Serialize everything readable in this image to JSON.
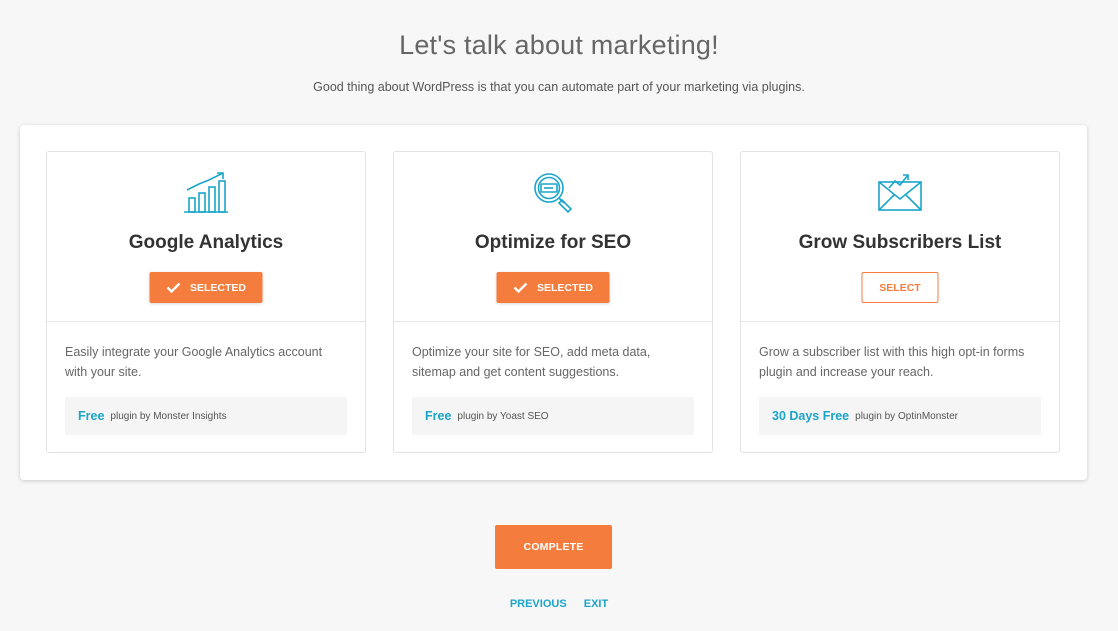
{
  "header": {
    "title": "Let's talk about marketing!",
    "subtitle": "Good thing about WordPress is that you can automate part of your marketing via plugins."
  },
  "cards": [
    {
      "icon": "bar-chart-growth-icon",
      "title": "Google Analytics",
      "button_label": "SELECTED",
      "selected": true,
      "description": "Easily integrate your Google Analytics account with your site.",
      "price": "Free",
      "plugin_by": "plugin by Monster Insights"
    },
    {
      "icon": "seo-magnifier-icon",
      "title": "Optimize for SEO",
      "button_label": "SELECTED",
      "selected": true,
      "description": "Optimize your site for SEO, add meta data, sitemap and get content suggestions.",
      "price": "Free",
      "plugin_by": "plugin by Yoast SEO"
    },
    {
      "icon": "envelope-growth-icon",
      "title": "Grow Subscribers List",
      "button_label": "SELECT",
      "selected": false,
      "description": "Grow a subscriber list with this high opt-in forms plugin and increase your reach.",
      "price": "30 Days Free",
      "plugin_by": "plugin by OptinMonster"
    }
  ],
  "footer": {
    "complete_label": "COMPLETE",
    "previous_label": "PREVIOUS",
    "exit_label": "EXIT"
  },
  "colors": {
    "accent": "#f47c3c",
    "link": "#1aa5c9",
    "icon": "#1aa5c9"
  }
}
